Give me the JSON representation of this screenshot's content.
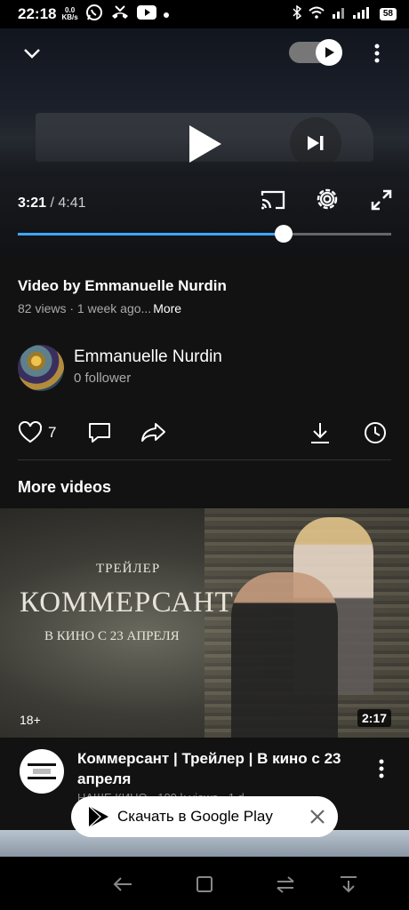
{
  "status_bar": {
    "time": "22:18",
    "net_speed_value": "0.0",
    "net_speed_unit": "KB/s",
    "battery": "58"
  },
  "player": {
    "current_time": "3:21",
    "separator": " / ",
    "duration": "4:41",
    "progress": 0.713
  },
  "video": {
    "title": "Video by Emmanuelle Nurdin",
    "meta": "82 views · 1 week ago...",
    "more_label": "More"
  },
  "channel": {
    "name": "Emmanuelle Nurdin",
    "subscribers": "0 follower"
  },
  "actions": {
    "like_count": "7"
  },
  "more_videos": {
    "section_title": "More videos",
    "item": {
      "thumb_trailer": "ТРЕЙЛЕР",
      "thumb_title": "КОММЕРСАНТ",
      "thumb_release": "В КИНО С 23 АПРЕЛЯ",
      "age_rating": "18+",
      "duration": "2:17",
      "title": "Коммерсант | Трейлер | В кино с 23 апреля",
      "sub": "НАШЕ КИНО · 100 k views · 1 d"
    }
  },
  "gplay_banner": {
    "label": "Скачать в Google Play"
  },
  "colors": {
    "accent": "#3ea6ff",
    "background": "#121212"
  }
}
